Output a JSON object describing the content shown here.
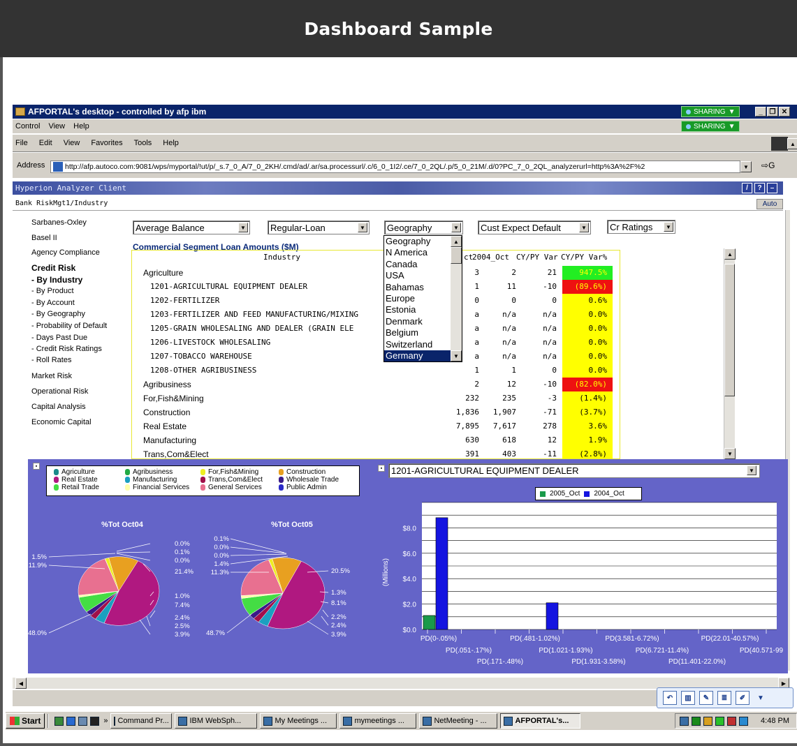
{
  "slide_title": "Dashboard Sample",
  "window": {
    "title": "AFPORTAL's desktop - controlled by afp ibm",
    "sharing_label": "SHARING",
    "sharing_label_2": "SHARING",
    "app_menu": [
      "Control",
      "View",
      "Help"
    ]
  },
  "browser": {
    "menu": [
      "File",
      "Edit",
      "View",
      "Favorites",
      "Tools",
      "Help"
    ],
    "address_label": "Address",
    "url": "http://afp.autoco.com:9081/wps/myportal/!ut/p/_s.7_0_A/7_0_2KH/.cmd/ad/.ar/sa.processurl/.c/6_0_1I2/.ce/7_0_2QL/.p/5_0_21M/.d/0?PC_7_0_2QL_analyzerurl=http%3A%2F%2",
    "go_label": "G"
  },
  "hyperion": {
    "title": "Hyperion Analyzer Client",
    "breadcrumb": "Bank RiskMgt1/Industry",
    "auto_label": "Auto",
    "icons": [
      "edit-icon",
      "help-icon",
      "minimize-icon"
    ]
  },
  "nav": {
    "items": [
      {
        "label": "Sarbanes-Oxley",
        "bold": false
      },
      {
        "label": "Basel II",
        "bold": false
      },
      {
        "label": "Agency Compliance",
        "bold": false
      },
      {
        "label": "Credit Risk",
        "bold": true
      },
      {
        "label": "- By Industry",
        "bold": true
      },
      {
        "label": "- By Product",
        "bold": false
      },
      {
        "label": "- By Account",
        "bold": false
      },
      {
        "label": "- By Geography",
        "bold": false
      },
      {
        "label": "- Probability of Default",
        "bold": false
      },
      {
        "label": "- Days Past Due",
        "bold": false
      },
      {
        "label": "- Credit Risk Ratings",
        "bold": false
      },
      {
        "label": "- Roll Rates",
        "bold": false
      },
      {
        "label": "Market Risk",
        "bold": false
      },
      {
        "label": "Operational Risk",
        "bold": false
      },
      {
        "label": "Capital Analysis",
        "bold": false
      },
      {
        "label": "Economic Capital",
        "bold": false
      }
    ]
  },
  "filters": {
    "measure": "Average Balance",
    "product": "Regular-Loan",
    "dimension": "Geography",
    "metric": "Cust Expect Default",
    "ratings": "Cr Ratings"
  },
  "geography_options": [
    "Geography",
    "N America",
    "Canada",
    "USA",
    "Bahamas",
    "Europe",
    "Estonia",
    "Denmark",
    "Belgium",
    "Switzerland",
    "Germany"
  ],
  "geography_selected": "Germany",
  "table": {
    "title": "Commercial Segment Loan Amounts ($M)",
    "headers": {
      "industry": "Industry",
      "c2005_partial": "ct",
      "c2004": "2004_Oct",
      "var": "CY/PY Var",
      "var_pct": "CY/PY Var%"
    },
    "rows": [
      {
        "industry": "Agriculture",
        "indent": false,
        "c2005": "3",
        "c2004": "2",
        "var": "21",
        "pct": "947.5%",
        "status": "green"
      },
      {
        "industry": "1201-AGRICULTURAL EQUIPMENT DEALER",
        "indent": true,
        "c2005": "1",
        "c2004": "11",
        "var": "-10",
        "pct": "(89.6%)",
        "status": "red"
      },
      {
        "industry": "1202-FERTILIZER",
        "indent": true,
        "c2005": "0",
        "c2004": "0",
        "var": "0",
        "pct": "0.6%",
        "status": "yellow"
      },
      {
        "industry": "1203-FERTILIZER AND FEED MANUFACTURING/MIXING",
        "indent": true,
        "c2005": "a",
        "c2004": "n/a",
        "var": "n/a",
        "pct": "0.0%",
        "status": "yellow"
      },
      {
        "industry": "1205-GRAIN WHOLESALING AND DEALER (GRAIN ELE",
        "indent": true,
        "c2005": "a",
        "c2004": "n/a",
        "var": "n/a",
        "pct": "0.0%",
        "status": "yellow"
      },
      {
        "industry": "1206-LIVESTOCK WHOLESALING",
        "indent": true,
        "c2005": "a",
        "c2004": "n/a",
        "var": "n/a",
        "pct": "0.0%",
        "status": "yellow"
      },
      {
        "industry": "1207-TOBACCO WAREHOUSE",
        "indent": true,
        "c2005": "a",
        "c2004": "n/a",
        "var": "n/a",
        "pct": "0.0%",
        "status": "yellow"
      },
      {
        "industry": "1208-OTHER AGRIBUSINESS",
        "indent": true,
        "c2005": "1",
        "c2004": "1",
        "var": "0",
        "pct": "0.0%",
        "status": "yellow"
      },
      {
        "industry": "Agribusiness",
        "indent": false,
        "c2005": "2",
        "c2004": "12",
        "var": "-10",
        "pct": "(82.0%)",
        "status": "red"
      },
      {
        "industry": "For,Fish&Mining",
        "indent": false,
        "c2005": "232",
        "c2004": "235",
        "var": "-3",
        "pct": "(1.4%)",
        "status": "yellow"
      },
      {
        "industry": "Construction",
        "indent": false,
        "c2005": "1,836",
        "c2004": "1,907",
        "var": "-71",
        "pct": "(3.7%)",
        "status": "yellow"
      },
      {
        "industry": "Real Estate",
        "indent": false,
        "c2005": "7,895",
        "c2004": "7,617",
        "var": "278",
        "pct": "3.6%",
        "status": "yellow"
      },
      {
        "industry": "Manufacturing",
        "indent": false,
        "c2005": "630",
        "c2004": "618",
        "var": "12",
        "pct": "1.9%",
        "status": "yellow"
      },
      {
        "industry": "Trans,Com&Elect",
        "indent": false,
        "c2005": "391",
        "c2004": "403",
        "var": "-11",
        "pct": "(2.8%)",
        "status": "yellow"
      }
    ]
  },
  "status_colors": {
    "green": "#22ee22",
    "red": "#ee1111",
    "yellow": "#ffff00"
  },
  "industry_legend": [
    {
      "label": "Agriculture",
      "color": "#1a8a8a"
    },
    {
      "label": "Agribusiness",
      "color": "#22aa44"
    },
    {
      "label": "For,Fish&Mining",
      "color": "#eeee22"
    },
    {
      "label": "Construction",
      "color": "#e8a020"
    },
    {
      "label": "Real Estate",
      "color": "#b01880"
    },
    {
      "label": "Manufacturing",
      "color": "#1ba0c0"
    },
    {
      "label": "Trans,Com&Elect",
      "color": "#a0104a"
    },
    {
      "label": "Wholesale Trade",
      "color": "#3a1a88"
    },
    {
      "label": "Retail Trade",
      "color": "#44dd44"
    },
    {
      "label": "Financial Services",
      "color": "#ffffaa"
    },
    {
      "label": "General Services",
      "color": "#e87090"
    },
    {
      "label": "Public Admin",
      "color": "#2a2ac8"
    }
  ],
  "chart_data": [
    {
      "type": "pie",
      "title": "%Tot Oct04",
      "labels": [
        "0.0%",
        "0.1%",
        "0.0%",
        "21.4%",
        "1.0%",
        "7.4%",
        "2.4%",
        "2.5%",
        "3.9%",
        "48.0%",
        "11.9%",
        "1.5%"
      ],
      "slices": [
        {
          "category": "Agriculture",
          "value": 0.0
        },
        {
          "category": "Agribusiness",
          "value": 0.1
        },
        {
          "category": "For,Fish&Mining",
          "value": 1.5
        },
        {
          "category": "Construction",
          "value": 11.9
        },
        {
          "category": "Real Estate",
          "value": 48.0
        },
        {
          "category": "Manufacturing",
          "value": 3.9
        },
        {
          "category": "Trans,Com&Elect",
          "value": 2.5
        },
        {
          "category": "Wholesale Trade",
          "value": 2.4
        },
        {
          "category": "Retail Trade",
          "value": 7.4
        },
        {
          "category": "Financial Services",
          "value": 1.0
        },
        {
          "category": "General Services",
          "value": 21.4
        },
        {
          "category": "Public Admin",
          "value": 0.0
        }
      ]
    },
    {
      "type": "pie",
      "title": "%Tot Oct05",
      "labels": [
        "0.1%",
        "0.0%",
        "0.0%",
        "1.4%",
        "11.3%",
        "20.5%",
        "1.3%",
        "8.1%",
        "2.2%",
        "2.4%",
        "3.9%",
        "48.7%"
      ],
      "slices": [
        {
          "category": "Agriculture",
          "value": 0.1
        },
        {
          "category": "Agribusiness",
          "value": 0.0
        },
        {
          "category": "For,Fish&Mining",
          "value": 1.4
        },
        {
          "category": "Construction",
          "value": 11.3
        },
        {
          "category": "Real Estate",
          "value": 48.7
        },
        {
          "category": "Manufacturing",
          "value": 3.9
        },
        {
          "category": "Trans,Com&Elect",
          "value": 2.4
        },
        {
          "category": "Wholesale Trade",
          "value": 2.2
        },
        {
          "category": "Retail Trade",
          "value": 8.1
        },
        {
          "category": "Financial Services",
          "value": 1.3
        },
        {
          "category": "General Services",
          "value": 20.5
        },
        {
          "category": "Public Admin",
          "value": 0.0
        }
      ]
    },
    {
      "type": "bar",
      "title": "",
      "ylabel": "(Millions)",
      "ylim": [
        0,
        10
      ],
      "yticks": [
        "$0.0",
        "$2.0",
        "$4.0",
        "$6.0",
        "$8.0"
      ],
      "categories": [
        "PD(0-.05%)",
        "PD(.051-.17%)",
        "PD(.171-.48%)",
        "PD(.481-1.02%)",
        "PD(1.021-1.93%)",
        "PD(1.931-3.58%)",
        "PD(3.581-6.72%)",
        "PD(6.721-11.4%)",
        "PD(11.401-22.0%)",
        "PD(22.01-40.57%)",
        "PD(40.571-99"
      ],
      "series": [
        {
          "name": "2005_Oct",
          "color": "#1a9a4a",
          "values": [
            1.1,
            0,
            0,
            0,
            0,
            0,
            0,
            0,
            0,
            0,
            0
          ]
        },
        {
          "name": "2004_Oct",
          "color": "#1414e0",
          "values": [
            8.8,
            0,
            0,
            2.1,
            0,
            0,
            0,
            0,
            0,
            0,
            0
          ]
        }
      ],
      "grid": true
    }
  ],
  "right_chart_select": "1201-AGRICULTURAL EQUIPMENT DEALER",
  "taskbar": {
    "start": "Start",
    "chevron": "»",
    "tasks": [
      "Command Pr...",
      "IBM WebSph...",
      "My Meetings ...",
      "mymeetings ...",
      "NetMeeting - ...",
      "AFPORTAL's..."
    ],
    "clock": "4:48 PM"
  }
}
